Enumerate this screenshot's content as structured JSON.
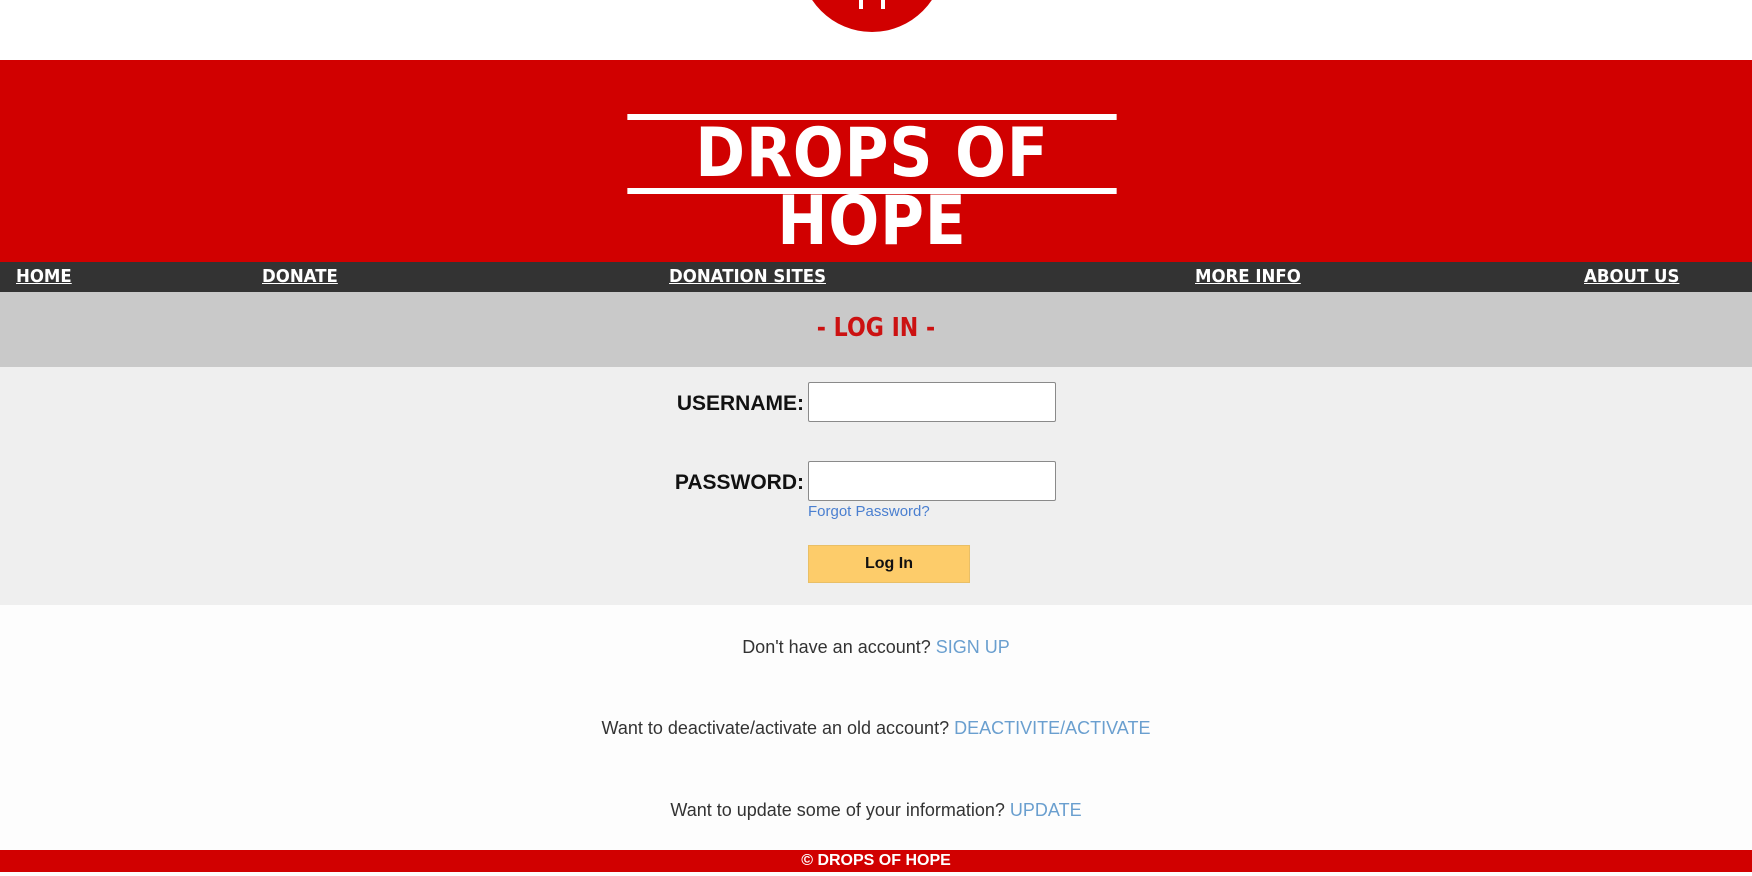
{
  "brand": {
    "title": "DROPS OF HOPE",
    "logo_icon": "blood-drop-logo-icon",
    "primary_color": "#d10000",
    "nav_color": "#333333"
  },
  "nav": {
    "items": [
      {
        "label": "HOME"
      },
      {
        "label": "DONATE"
      },
      {
        "label": "DONATION SITES"
      },
      {
        "label": "MORE INFO"
      },
      {
        "label": "ABOUT US"
      }
    ]
  },
  "login": {
    "heading": "- LOG IN -",
    "username_label": "USERNAME:",
    "username_value": "",
    "password_label": "PASSWORD:",
    "password_value": "",
    "forgot_label": "Forgot Password?",
    "submit_label": "Log In",
    "button_color": "#fdcc6a"
  },
  "links": {
    "signup_prompt": "Don't have an account?",
    "signup_link": "SIGN UP",
    "deactivate_prompt": "Want to deactivate/activate an old account?",
    "deactivate_link": "DEACTIVITE/ACTIVATE",
    "update_prompt": "Want to update some of your information?",
    "update_link": "UPDATE"
  },
  "footer": {
    "text": "© DROPS OF HOPE"
  }
}
